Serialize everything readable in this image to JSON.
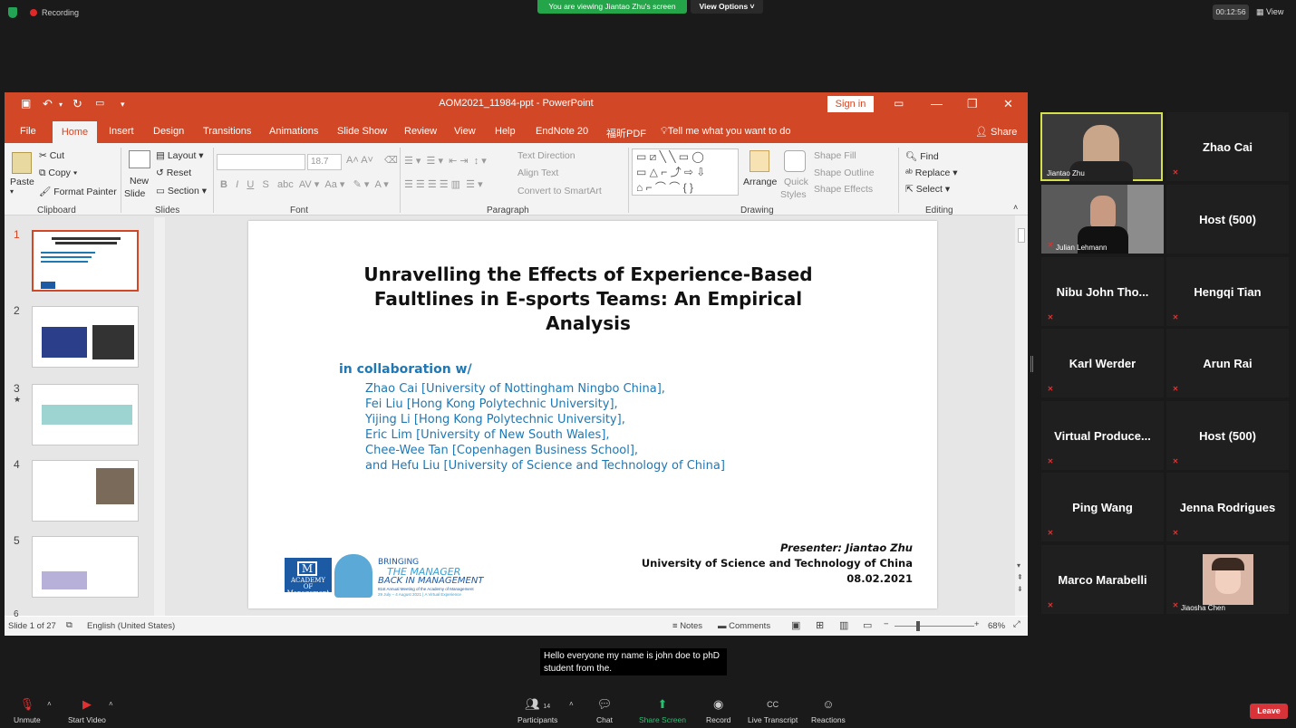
{
  "top": {
    "recording": "Recording",
    "viewing_banner": "You are viewing Jiantao Zhu's screen",
    "view_options": "View Options ˅",
    "timer": "00:12:56",
    "view": "View"
  },
  "ppt": {
    "title": "AOM2021_11984-ppt - PowerPoint",
    "sign_in": "Sign in",
    "tabs": [
      "File",
      "Home",
      "Insert",
      "Design",
      "Transitions",
      "Animations",
      "Slide Show",
      "Review",
      "View",
      "Help",
      "EndNote 20",
      "福昕PDF",
      "Tell me what you want to do",
      "Share"
    ],
    "ribbon": {
      "paste": "Paste",
      "cut": "Cut",
      "copy": "Copy",
      "format_painter": "Format Painter",
      "clipboard": "Clipboard",
      "new_slide": "New",
      "new_slide2": "Slide",
      "layout": "Layout",
      "reset": "Reset",
      "section": "Section",
      "slides": "Slides",
      "font_size": "18.7",
      "font": "Font",
      "text_direction": "Text Direction",
      "align_text": "Align Text",
      "convert_smartart": "Convert to SmartArt",
      "paragraph": "Paragraph",
      "arrange": "Arrange",
      "quick_styles": "Quick",
      "quick_styles2": "Styles",
      "shape_fill": "Shape Fill",
      "shape_outline": "Shape Outline",
      "shape_effects": "Shape Effects",
      "drawing": "Drawing",
      "find": "Find",
      "replace": "Replace",
      "select": "Select",
      "editing": "Editing"
    },
    "slide": {
      "title": "Unravelling the Effects of Experience-Based Faultlines in E-sports Teams: An Empirical Analysis",
      "collab": "in collaboration w/",
      "authors": [
        "Zhao Cai [University of Nottingham Ningbo China],",
        "Fei Liu [Hong Kong Polytechnic University],",
        "Yijing Li [Hong Kong Polytechnic University],",
        "Eric Lim [University of New South Wales],",
        "Chee-Wee Tan [Copenhagen Business School],",
        "and Hefu Liu [University of Science and Technology of China]"
      ],
      "presenter": "Presenter: Jiantao Zhu",
      "affiliation": "University of Science and Technology of China",
      "date": "08.02.2021",
      "logo_text": "ACADEMY OF Management",
      "bringing": "BRINGING",
      "the_manager": "THE MANAGER",
      "back_in": "BACK IN MANAGEMENT",
      "meeting": "81st Annual Meeting of the Academy of Management",
      "meeting_dates": "29 July – 4 August 2021 | A Virtual Experience"
    },
    "thumb_numbers": [
      "1",
      "2",
      "3",
      "4",
      "5",
      "6"
    ],
    "status": {
      "slide_of": "Slide 1 of 27",
      "language": "English (United States)",
      "notes": "Notes",
      "comments": "Comments",
      "zoom": "68%"
    }
  },
  "participants": [
    {
      "name": "Jiantao Zhu",
      "video": true
    },
    {
      "name": "Zhao Cai",
      "video": false
    },
    {
      "name": "Julian Lehmann",
      "video": true
    },
    {
      "name": "Host (500)",
      "video": false
    },
    {
      "name": "Nibu John Tho...",
      "video": false
    },
    {
      "name": "Hengqi Tian",
      "video": false
    },
    {
      "name": "Karl Werder",
      "video": false
    },
    {
      "name": "Arun Rai",
      "video": false
    },
    {
      "name": "Virtual Produce...",
      "video": false
    },
    {
      "name": "Host (500)",
      "video": false
    },
    {
      "name": "Ping Wang",
      "video": false
    },
    {
      "name": "Jenna Rodrigues",
      "video": false
    },
    {
      "name": "Marco Marabelli",
      "video": false
    },
    {
      "name": "Jiaosha Chen",
      "video": true
    }
  ],
  "caption": "Hello everyone my name is john doe to phD student from the.",
  "toolbar": {
    "unmute": "Unmute",
    "start_video": "Start Video",
    "participants": "Participants",
    "participants_count": "14",
    "chat": "Chat",
    "share_screen": "Share Screen",
    "record": "Record",
    "live_transcript": "Live Transcript",
    "reactions": "Reactions",
    "leave": "Leave"
  }
}
